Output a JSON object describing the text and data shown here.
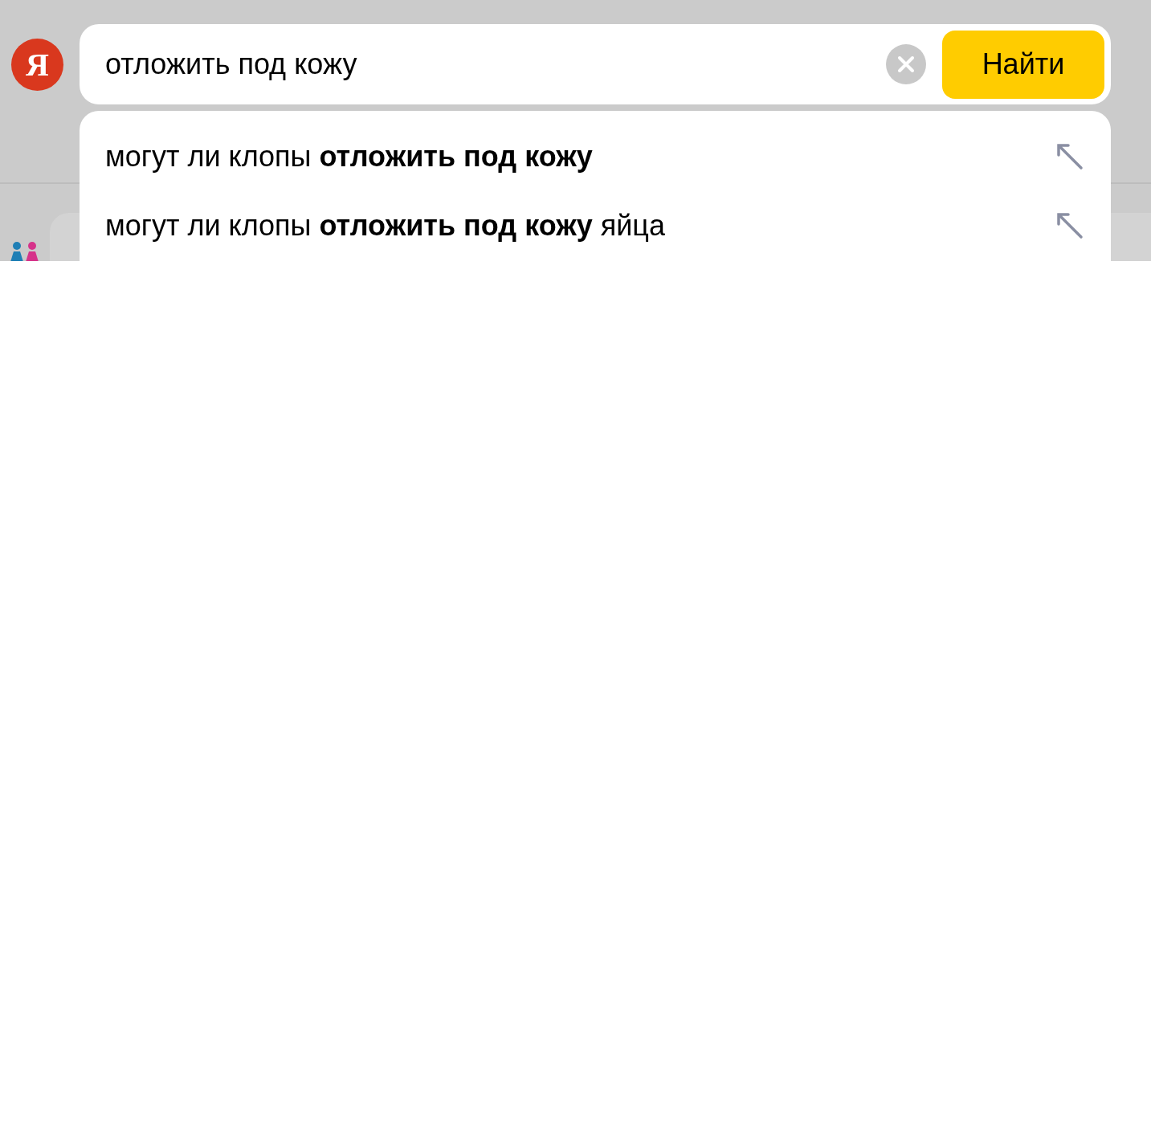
{
  "logo": {
    "letter": "Я"
  },
  "search": {
    "value": "отложить под кожу",
    "button": "Найти"
  },
  "suggestions": [
    {
      "text": "могут ли клопы **отложить под кожу**"
    },
    {
      "text": "могут ли клопы **отложить под кожу** яйца"
    }
  ]
}
